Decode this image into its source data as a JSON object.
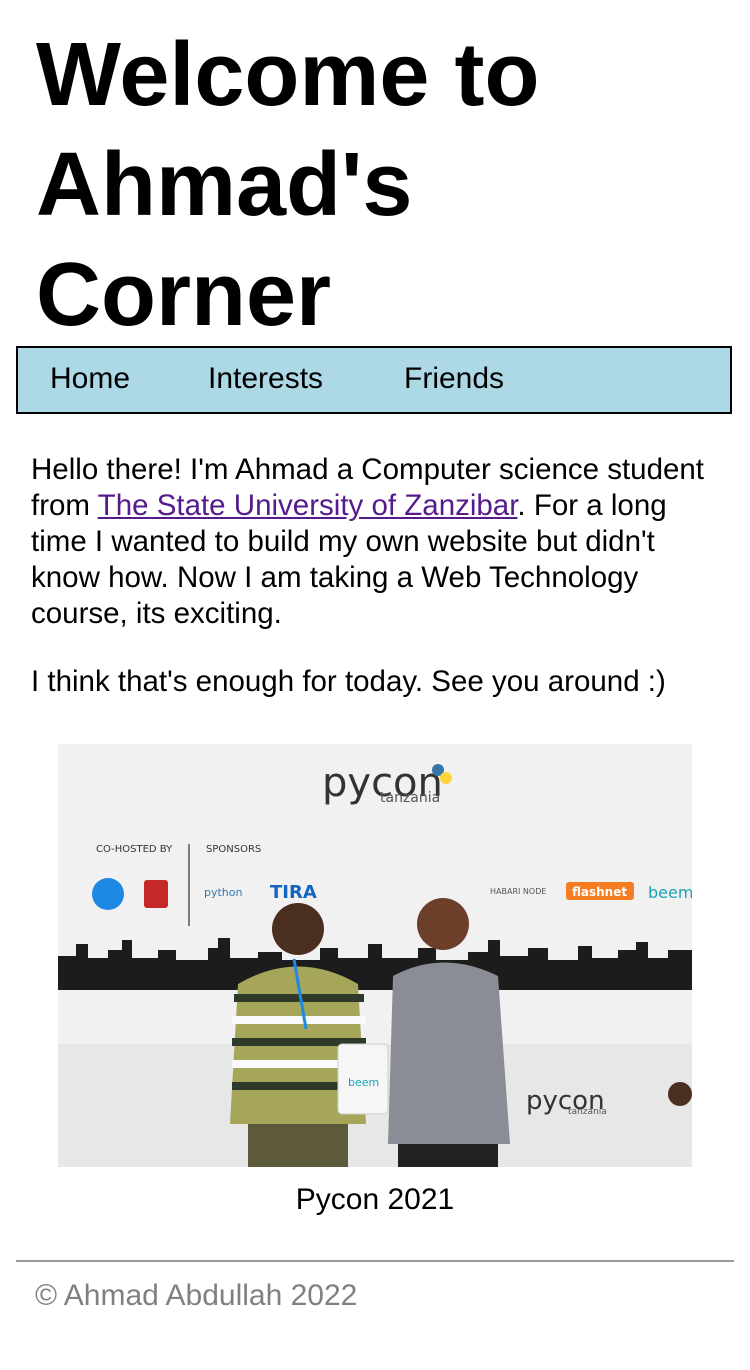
{
  "header": {
    "title": "Welcome to Ahmad's Corner"
  },
  "nav": {
    "items": [
      {
        "label": "Home"
      },
      {
        "label": "Interests"
      },
      {
        "label": "Friends"
      }
    ]
  },
  "intro": {
    "text_before_link": "Hello there! I'm Ahmad a Computer science student from ",
    "link_text": "The State University of Zanzibar",
    "text_after_link": ". For a long time I wanted to build my own website but didn't know how. Now I am taking a Web Technology course, its exciting.",
    "closing": "I think that's enough for today. See you around :)"
  },
  "photo": {
    "event_logo": "pycon",
    "event_logo_sub": "tanzania",
    "cohosted_label": "CO-HOSTED BY",
    "sponsors_label": "SPONSORS",
    "sponsor_logos": [
      "python",
      "TIRA",
      "flashnet",
      "beem",
      "HABARI NODE"
    ],
    "bag_label": "beem",
    "small_logo": "pycon",
    "small_logo_sub": "tanzania",
    "caption": "Pycon 2021"
  },
  "footer": {
    "text": "© Ahmad Abdullah 2022"
  },
  "colors": {
    "nav_bg": "#add8e6",
    "link": "#551a8b",
    "footer_text": "#808080"
  }
}
